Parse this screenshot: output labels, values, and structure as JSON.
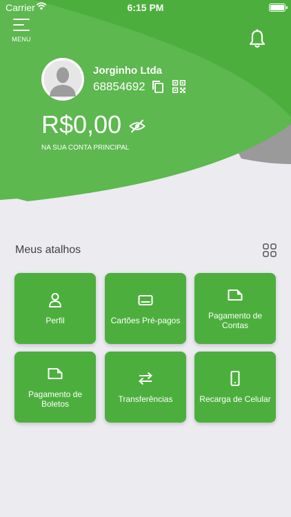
{
  "status_bar": {
    "carrier": "Carrier",
    "time": "6:15 PM"
  },
  "header": {
    "menu_label": "MENU",
    "company_name": "Jorginho Ltda",
    "account_number": "68854692",
    "balance": "R$0,00",
    "balance_caption": "NA SUA CONTA PRINCIPAL"
  },
  "shortcuts": {
    "title": "Meus atalhos",
    "items": [
      {
        "label": "Perfil",
        "icon": "person-icon"
      },
      {
        "label": "Cartões Pré-pagos",
        "icon": "card-icon"
      },
      {
        "label": "Pagamento de Contas",
        "icon": "document-icon"
      },
      {
        "label": "Pagamento de Boletos",
        "icon": "document-icon"
      },
      {
        "label": "Transferências",
        "icon": "transfer-arrows-icon"
      },
      {
        "label": "Recarga de Celular",
        "icon": "mobile-phone-icon"
      }
    ]
  },
  "colors": {
    "primary_green": "#4caf3d",
    "light_green": "#5db84f",
    "gray_band": "#9a9a9a",
    "background": "#ebebf0"
  }
}
